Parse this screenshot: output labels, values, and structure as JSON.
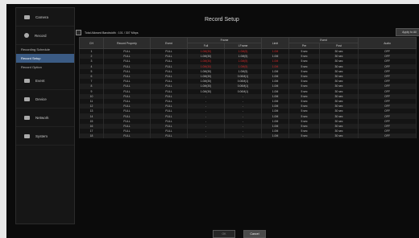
{
  "sidebar": {
    "items": [
      {
        "label": "Camera",
        "icon": "camera-icon"
      },
      {
        "label": "Record",
        "icon": "record-icon"
      }
    ],
    "sub_items": [
      "Recording Schedule",
      "Record Setup",
      "Record Option"
    ],
    "items_after": [
      {
        "label": "Event",
        "icon": "event-icon"
      },
      {
        "label": "Device",
        "icon": "device-icon"
      },
      {
        "label": "Network",
        "icon": "network-icon"
      },
      {
        "label": "System",
        "icon": "system-icon"
      }
    ]
  },
  "main": {
    "title": "Record Setup",
    "all_day_label": "Total Allowed Bandwidth : 101 / 307 Mbps",
    "apply_label": "Apply to All",
    "headers": {
      "ch": "CH",
      "record_property": "Record Property",
      "event": "Event",
      "frame": "Frame",
      "full": "Full",
      "i_frame": "I-Frame",
      "limit": "Limit",
      "event_group": "Event",
      "pre": "Pre",
      "post": "Post",
      "audio": "Audio"
    },
    "rows": [
      {
        "ch": "1",
        "prop": "FULL",
        "event": "FULL",
        "full": "1.0M(30)",
        "iframe": "1.0M(5)",
        "limit": "1.0M",
        "pre": "5 sec",
        "post": "30 sec",
        "audio": "OFF",
        "red": true
      },
      {
        "ch": "2",
        "prop": "FULL",
        "event": "FULL",
        "full": "1.0M(30)",
        "iframe": "1.0M(5)",
        "limit": "1.0M",
        "pre": "5 sec",
        "post": "30 sec",
        "audio": "OFF",
        "red": false
      },
      {
        "ch": "3",
        "prop": "FULL",
        "event": "FULL",
        "full": "1.0M(30)",
        "iframe": "1.0M(5)",
        "limit": "1.0M",
        "pre": "5 sec",
        "post": "30 sec",
        "audio": "OFF",
        "red": true
      },
      {
        "ch": "4",
        "prop": "FULL",
        "event": "FULL",
        "full": "1.0M(30)",
        "iframe": "1.0M(5)",
        "limit": "1.0M",
        "pre": "5 sec",
        "post": "30 sec",
        "audio": "OFF",
        "red": true
      },
      {
        "ch": "5",
        "prop": "FULL",
        "event": "FULL",
        "full": "1.0M(30)",
        "iframe": "1.0M(5)",
        "limit": "1.0M",
        "pre": "5 sec",
        "post": "30 sec",
        "audio": "OFF",
        "red": false
      },
      {
        "ch": "6",
        "prop": "FULL",
        "event": "FULL",
        "full": "1.0M(30)",
        "iframe": "0.06M(1)",
        "limit": "1.0M",
        "pre": "5 sec",
        "post": "30 sec",
        "audio": "OFF",
        "red": false
      },
      {
        "ch": "7",
        "prop": "FULL",
        "event": "FULL",
        "full": "1.0M(30)",
        "iframe": "0.06M(1)",
        "limit": "1.0M",
        "pre": "5 sec",
        "post": "30 sec",
        "audio": "OFF",
        "red": false
      },
      {
        "ch": "8",
        "prop": "FULL",
        "event": "FULL",
        "full": "1.0M(30)",
        "iframe": "0.06M(1)",
        "limit": "1.0M",
        "pre": "5 sec",
        "post": "30 sec",
        "audio": "OFF",
        "red": false
      },
      {
        "ch": "9",
        "prop": "FULL",
        "event": "FULL",
        "full": "1.0M(30)",
        "iframe": "0.06M(1)",
        "limit": "1.0M",
        "pre": "5 sec",
        "post": "30 sec",
        "audio": "OFF",
        "red": false
      },
      {
        "ch": "10",
        "prop": "FULL",
        "event": "FULL",
        "full": "-",
        "iframe": "-",
        "limit": "1.0M",
        "pre": "5 sec",
        "post": "30 sec",
        "audio": "OFF",
        "red": false
      },
      {
        "ch": "11",
        "prop": "FULL",
        "event": "FULL",
        "full": "-",
        "iframe": "-",
        "limit": "1.0M",
        "pre": "5 sec",
        "post": "30 sec",
        "audio": "OFF",
        "red": false
      },
      {
        "ch": "12",
        "prop": "FULL",
        "event": "FULL",
        "full": "-",
        "iframe": "-",
        "limit": "1.0M",
        "pre": "5 sec",
        "post": "30 sec",
        "audio": "OFF",
        "red": false
      },
      {
        "ch": "13",
        "prop": "FULL",
        "event": "FULL",
        "full": "-",
        "iframe": "-",
        "limit": "1.0M",
        "pre": "5 sec",
        "post": "30 sec",
        "audio": "OFF",
        "red": false
      },
      {
        "ch": "14",
        "prop": "FULL",
        "event": "FULL",
        "full": "-",
        "iframe": "-",
        "limit": "1.0M",
        "pre": "5 sec",
        "post": "30 sec",
        "audio": "OFF",
        "red": false
      },
      {
        "ch": "15",
        "prop": "FULL",
        "event": "FULL",
        "full": "-",
        "iframe": "-",
        "limit": "1.0M",
        "pre": "5 sec",
        "post": "30 sec",
        "audio": "OFF",
        "red": false
      },
      {
        "ch": "16",
        "prop": "FULL",
        "event": "FULL",
        "full": "-",
        "iframe": "-",
        "limit": "1.0M",
        "pre": "5 sec",
        "post": "30 sec",
        "audio": "OFF",
        "red": false
      },
      {
        "ch": "17",
        "prop": "FULL",
        "event": "FULL",
        "full": "-",
        "iframe": "-",
        "limit": "1.0M",
        "pre": "5 sec",
        "post": "30 sec",
        "audio": "OFF",
        "red": false
      },
      {
        "ch": "18",
        "prop": "FULL",
        "event": "FULL",
        "full": "-",
        "iframe": "-",
        "limit": "1.0M",
        "pre": "5 sec",
        "post": "30 sec",
        "audio": "OFF",
        "red": false
      }
    ],
    "ok_label": "OK",
    "cancel_label": "Cancel"
  },
  "colors": {
    "accent": "#3b5b84",
    "warning": "#d12a2a",
    "background": "#0b0b0b"
  }
}
